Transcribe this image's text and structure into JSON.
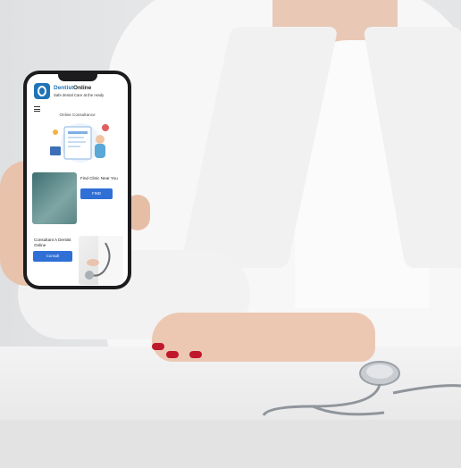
{
  "app": {
    "brand_part1": "Dentist",
    "brand_part2": "Online",
    "tagline": "Safe dental Care at the ready",
    "section_title": "Online Consultance"
  },
  "card_find": {
    "title": "Find Clinic Near You",
    "button_label": "FIND"
  },
  "card_consult": {
    "title": "Consultant A Dentist Online",
    "button_label": "Consult"
  },
  "colors": {
    "brand_blue": "#1f73b7",
    "button_blue": "#2f6fd6",
    "nail_red": "#c0182b"
  },
  "icons": [
    "tooth-logo-icon",
    "hamburger-menu-icon",
    "stethoscope-icon"
  ]
}
